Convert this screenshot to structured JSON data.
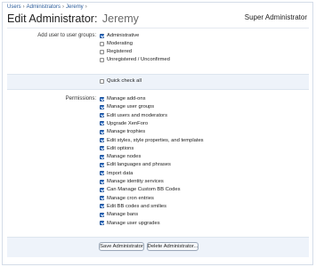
{
  "breadcrumb": [
    "Users",
    "Administrators",
    "Jeremy"
  ],
  "title": {
    "prefix": "Edit Administrator:",
    "name": "Jeremy"
  },
  "right_title": "Super Administrator",
  "groups": {
    "label": "Add user to user groups:",
    "items": [
      {
        "label": "Administrative",
        "checked": true
      },
      {
        "label": "Moderating",
        "checked": false
      },
      {
        "label": "Registered",
        "checked": false
      },
      {
        "label": "Unregistered / Unconfirmed",
        "checked": false
      }
    ]
  },
  "quick_check": {
    "label": "Quick check all",
    "checked": false
  },
  "permissions": {
    "label": "Permissions:",
    "items": [
      {
        "label": "Manage add-ons",
        "checked": true
      },
      {
        "label": "Manage user groups",
        "checked": true
      },
      {
        "label": "Edit users and moderators",
        "checked": true
      },
      {
        "label": "Upgrade XenForo",
        "checked": true
      },
      {
        "label": "Manage trophies",
        "checked": true
      },
      {
        "label": "Edit styles, style properties, and templates",
        "checked": true
      },
      {
        "label": "Edit options",
        "checked": true
      },
      {
        "label": "Manage nodes",
        "checked": true
      },
      {
        "label": "Edit languages and phrases",
        "checked": true
      },
      {
        "label": "Import data",
        "checked": true
      },
      {
        "label": "Manage identity services",
        "checked": true
      },
      {
        "label": "Can Manage Custom BB Codes",
        "checked": true
      },
      {
        "label": "Manage cron entries",
        "checked": true
      },
      {
        "label": "Edit BB codes and smilies",
        "checked": true
      },
      {
        "label": "Manage bans",
        "checked": true
      },
      {
        "label": "Manage user upgrades",
        "checked": true
      }
    ]
  },
  "buttons": {
    "save": "Save Administrator",
    "delete": "Delete Administrator..."
  },
  "colors": {
    "link": "#2a5b9a",
    "checkbox_checked": "#2d6fc7",
    "panel": "#eef3fa"
  }
}
